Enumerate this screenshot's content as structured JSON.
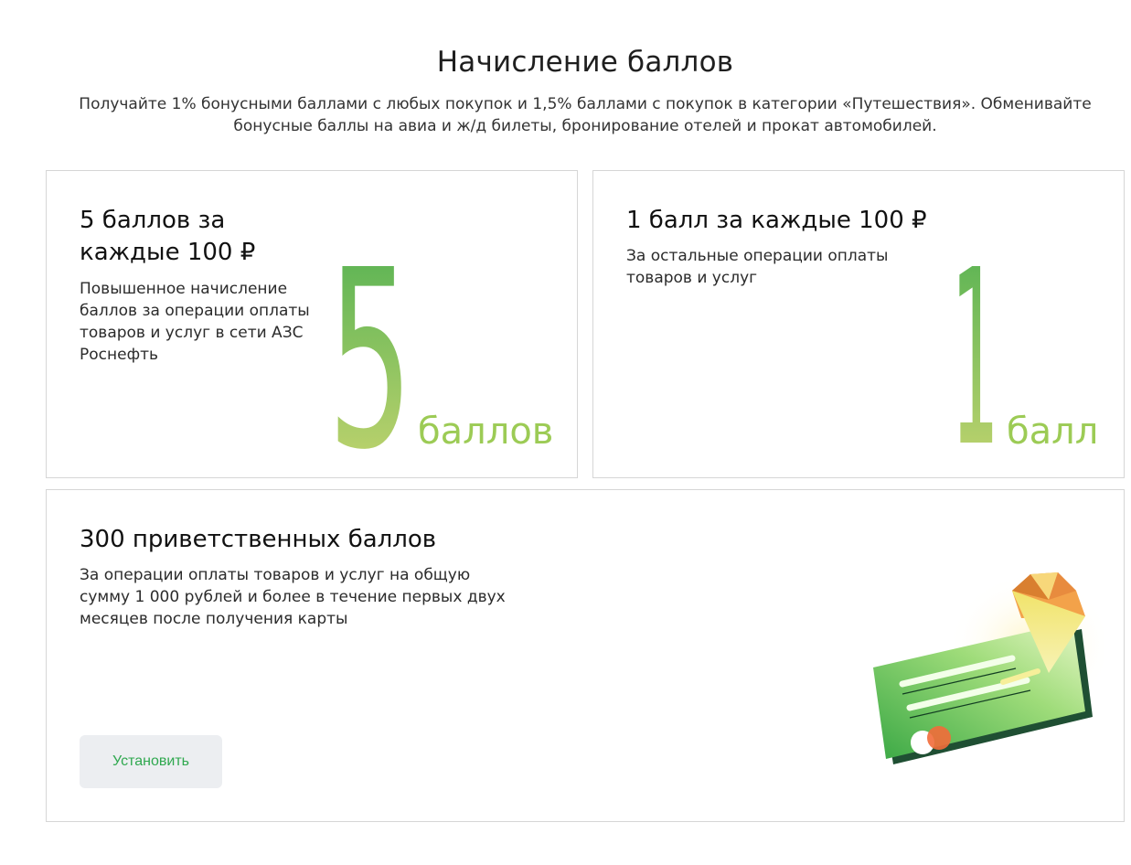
{
  "header": {
    "title": "Начисление баллов",
    "subtitle": "Получайте 1% бонусными баллами с любых покупок и 1,5% баллами с покупок в категории «Путешествия». Обменивайте бонусные баллы на авиа и ж/д билеты, бронирование отелей и прокат автомобилей."
  },
  "cards": [
    {
      "title": "5 баллов за каждые 100 ₽",
      "text": "Повышенное начисление баллов за операции оплаты товаров и услуг в сети АЗС Роснефть",
      "big_digit": "5",
      "unit": "баллов"
    },
    {
      "title": "1 балл за каждые 100 ₽",
      "text": "За остальные операции оплаты товаров и услуг",
      "big_digit": "1",
      "unit": "балл"
    },
    {
      "title": "300 приветственных баллов",
      "text": "За операции оплаты товаров и услуг на общую сумму 1 000 рублей и более в течение первых двух месяцев после получения карты",
      "button_label": "Установить",
      "illustration": "bank-card-with-gem"
    }
  ],
  "colors": {
    "accent_green": "#2fa84f",
    "gradient_top": "#4caf50",
    "gradient_bottom": "#cddc6f"
  }
}
